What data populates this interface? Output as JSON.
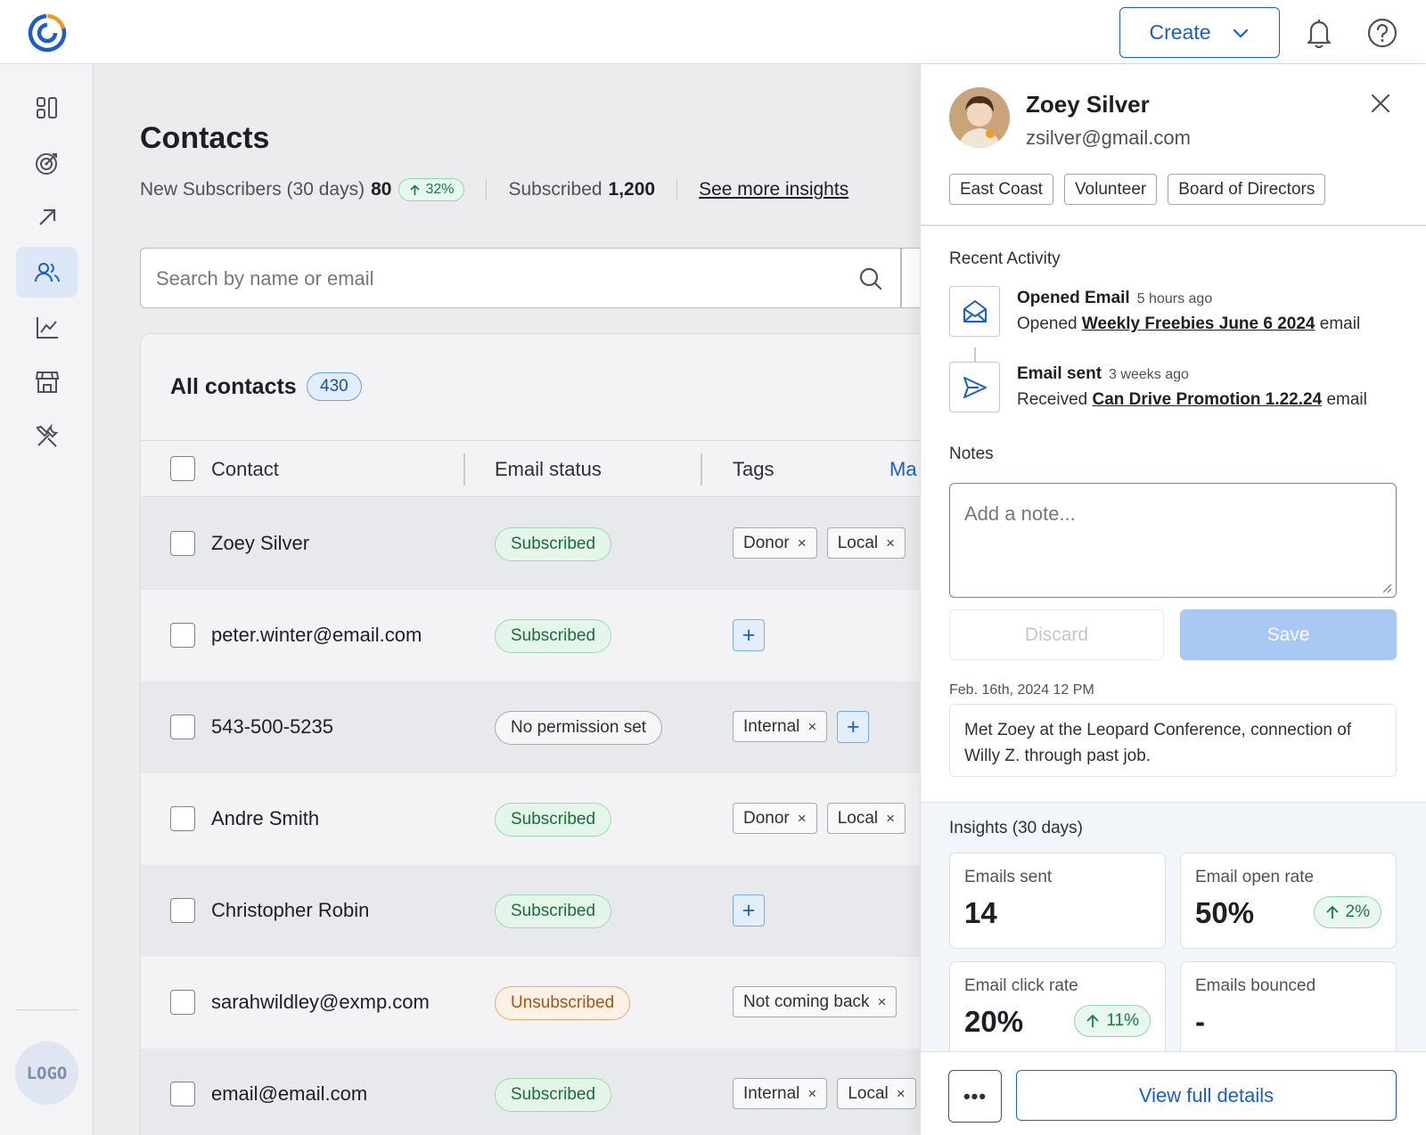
{
  "header": {
    "create_label": "Create",
    "icons": [
      "brand-logo-icon",
      "chevron-down-icon",
      "bell-icon",
      "help-icon"
    ]
  },
  "rail": {
    "items": [
      "dashboard-icon",
      "campaigns-icon",
      "automations-icon",
      "contacts-icon",
      "reports-icon",
      "store-icon",
      "tools-icon"
    ],
    "active": "contacts-icon",
    "logo_text": "LOGO"
  },
  "page": {
    "title": "Contacts",
    "new_subscribers_label": "New Subscribers (30 days)",
    "new_subscribers_value": "80",
    "new_subscribers_trend": "32%",
    "subscribed_label": "Subscribed",
    "subscribed_value": "1,200",
    "insights_link": "See more insights"
  },
  "search": {
    "placeholder": "Search by name or email"
  },
  "table": {
    "title": "All contacts",
    "count": "430",
    "columns": {
      "contact": "Contact",
      "email_status": "Email status",
      "tags": "Tags",
      "manage": "Ma"
    },
    "rows": [
      {
        "name": "Zoey Silver",
        "status": "Subscribed",
        "tags": [
          "Donor",
          "Local"
        ]
      },
      {
        "name": "peter.winter@email.com",
        "status": "Subscribed",
        "tags": []
      },
      {
        "name": "543-500-5235",
        "status": "No permission set",
        "tags": [
          "Internal"
        ]
      },
      {
        "name": "Andre Smith",
        "status": "Subscribed",
        "tags": [
          "Donor",
          "Local"
        ]
      },
      {
        "name": "Christopher Robin",
        "status": "Subscribed",
        "tags": []
      },
      {
        "name": "sarahwildley@exmp.com",
        "status": "Unsubscribed",
        "tags": [
          "Not coming back"
        ]
      },
      {
        "name": "email@email.com",
        "status": "Subscribed",
        "tags": [
          "Internal",
          "Local"
        ]
      }
    ],
    "tag_remove_glyph": "×",
    "add_tag_glyph": "+"
  },
  "panel": {
    "name": "Zoey Silver",
    "email": "zsilver@gmail.com",
    "tags": [
      "East Coast",
      "Volunteer",
      "Board of Directors"
    ],
    "recent_activity_label": "Recent Activity",
    "activities": [
      {
        "title": "Opened Email",
        "time": "5 hours ago",
        "prefix": "Opened",
        "link": "Weekly Freebies June 6 2024",
        "suffix": "email",
        "icon": "envelope-open-icon"
      },
      {
        "title": "Email sent",
        "time": "3 weeks ago",
        "prefix": "Received",
        "link": "Can Drive Promotion 1.22.24",
        "suffix": "email",
        "icon": "send-icon"
      }
    ],
    "notes_label": "Notes",
    "note_placeholder": "Add a note...",
    "discard_label": "Discard",
    "save_label": "Save",
    "note_date": "Feb. 16th, 2024 12 PM",
    "note_text": "Met Zoey at the Leopard Conference, connection of Willy Z. through past job.",
    "insights_label": "Insights (30 days)",
    "insights": [
      {
        "label": "Emails sent",
        "value": "14",
        "trend": ""
      },
      {
        "label": "Email open rate",
        "value": "50%",
        "trend": "2%"
      },
      {
        "label": "Email click rate",
        "value": "20%",
        "trend": "11%"
      },
      {
        "label": "Emails bounced",
        "value": "-",
        "trend": ""
      }
    ],
    "more_label": "•••",
    "full_details_label": "View full details"
  },
  "colors": {
    "accent": "#1a5fc8",
    "subscribed_bg": "#e4f6ea",
    "unsubscribed_bg": "#fdf0e4",
    "trend_green": "#1a7a43"
  }
}
